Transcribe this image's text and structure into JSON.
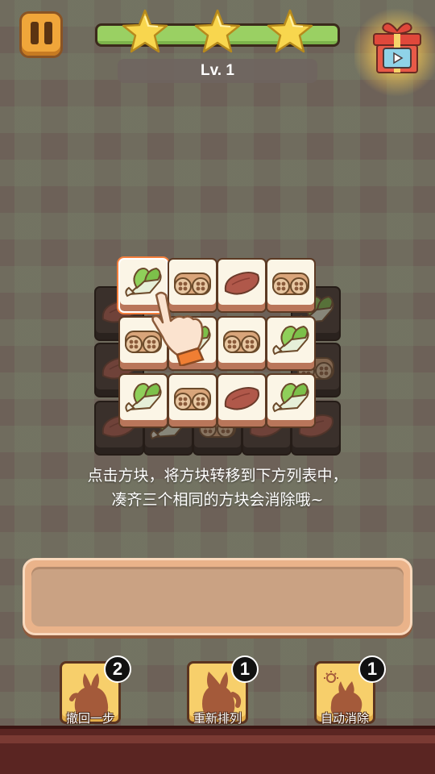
{
  "header": {
    "level_label": "Lv. 1",
    "stars": 3,
    "progress_percent": 100,
    "icons": [
      "pause-icon",
      "star-icon",
      "gift-video-icon"
    ]
  },
  "board": {
    "top_layer": [
      [
        "bok-choy",
        "lotus-root",
        "sweet-potato",
        "lotus-root"
      ],
      [
        "lotus-root",
        "bok-choy",
        "lotus-root",
        "bok-choy"
      ],
      [
        "bok-choy",
        "lotus-root",
        "sweet-potato",
        "bok-choy"
      ]
    ],
    "hint_line1": "点击方块，将方块转移到下方列表中，",
    "hint_line2": "凑齐三个相同的方块会消除哦~"
  },
  "tray": {
    "slots_filled": 0
  },
  "tools": [
    {
      "label": "撤回一步",
      "count": "2",
      "icon": "undo-bunny-icon"
    },
    {
      "label": "重新排列",
      "count": "1",
      "icon": "shuffle-bunny-icon"
    },
    {
      "label": "自动消除",
      "count": "1",
      "icon": "auto-clear-bunny-icon"
    }
  ],
  "colors": {
    "accent_orange": "#f0a63a",
    "progress_green": "#9ad063",
    "tile_face": "#fbf5e6",
    "tool_yellow": "#f7cf6b"
  }
}
